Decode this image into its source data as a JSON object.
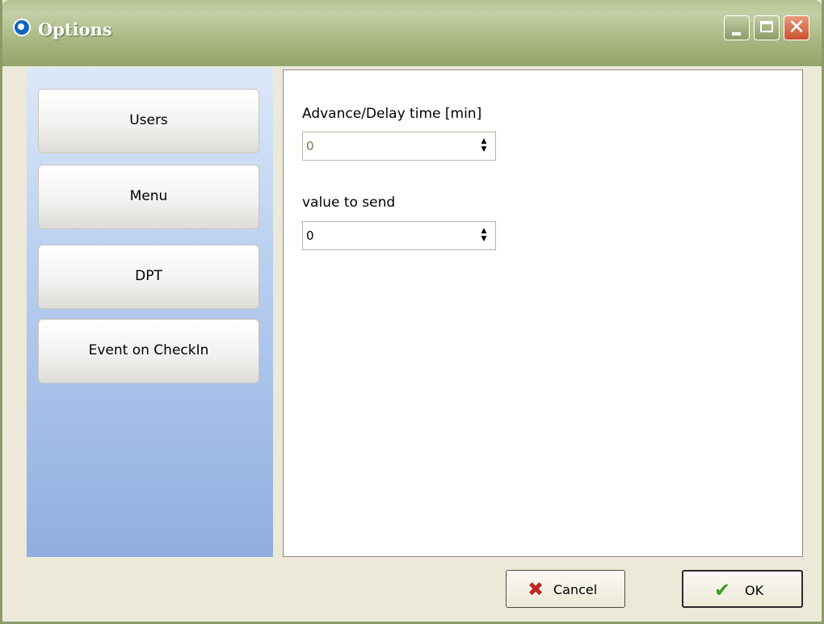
{
  "window": {
    "title": "Options",
    "controls": {
      "minimize": "minimize-icon",
      "maximize": "maximize-icon",
      "close": "close-icon"
    }
  },
  "sidebar": {
    "items": [
      {
        "label": "Users"
      },
      {
        "label": "Menu"
      },
      {
        "label": "DPT"
      },
      {
        "label": "Event on CheckIn"
      }
    ]
  },
  "content": {
    "fields": [
      {
        "label": "Advance/Delay time [min]",
        "value": "0",
        "enabled": false
      },
      {
        "label": "value to send",
        "value": "0",
        "enabled": true
      }
    ]
  },
  "footer": {
    "cancel_label": "Cancel",
    "ok_label": "OK"
  },
  "colors": {
    "title_bar": "#a9b882",
    "sidebar_top": "#dce8f9",
    "sidebar_bottom": "#8faee0",
    "cancel_icon": "#c0261e",
    "ok_icon": "#3b9b1e"
  }
}
